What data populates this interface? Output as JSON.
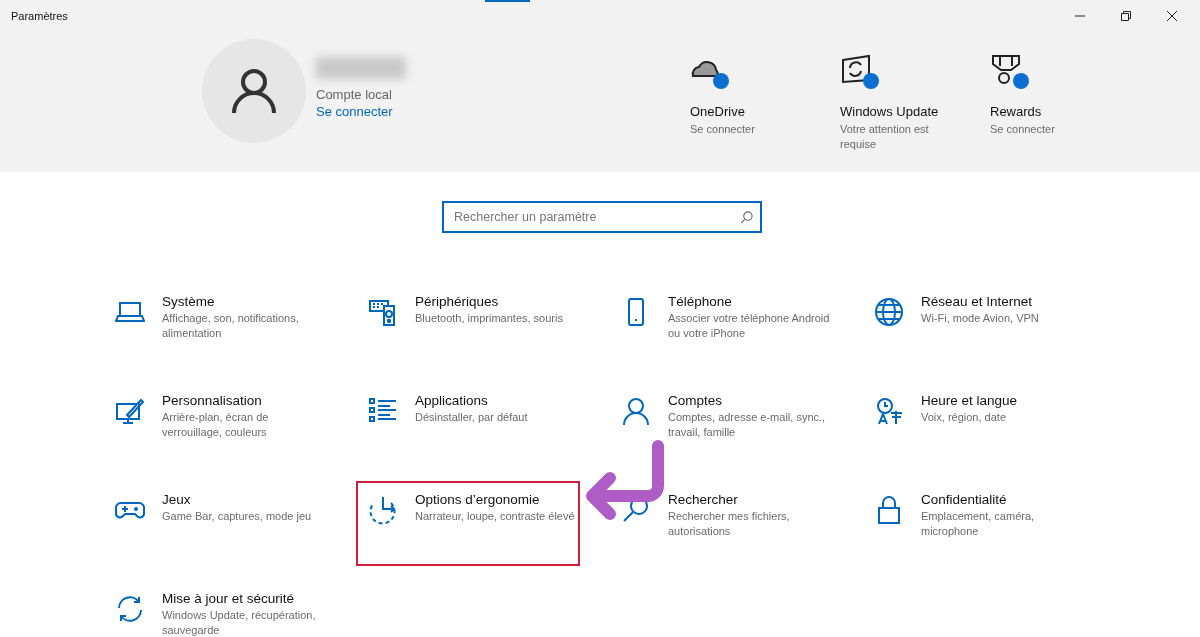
{
  "window": {
    "title": "Paramètres"
  },
  "account": {
    "type": "Compte local",
    "link": "Se connecter"
  },
  "quick_links": [
    {
      "title": "OneDrive",
      "subtitle": "Se connecter"
    },
    {
      "title": "Windows Update",
      "subtitle": "Votre attention est requise"
    },
    {
      "title": "Rewards",
      "subtitle": "Se connecter"
    }
  ],
  "search": {
    "placeholder": "Rechercher un paramètre"
  },
  "categories": [
    {
      "title": "Système",
      "subtitle": "Affichage, son, notifications, alimentation",
      "highlighted": false
    },
    {
      "title": "Périphériques",
      "subtitle": "Bluetooth, imprimantes, souris",
      "highlighted": false
    },
    {
      "title": "Téléphone",
      "subtitle": "Associer votre téléphone Android ou votre iPhone",
      "highlighted": false
    },
    {
      "title": "Réseau et Internet",
      "subtitle": "Wi-Fi, mode Avion, VPN",
      "highlighted": false
    },
    {
      "title": "Personnalisation",
      "subtitle": "Arrière-plan, écran de verrouillage, couleurs",
      "highlighted": false
    },
    {
      "title": "Applications",
      "subtitle": "Désinstaller, par défaut",
      "highlighted": false
    },
    {
      "title": "Comptes",
      "subtitle": "Comptes, adresse e-mail, sync., travail, famille",
      "highlighted": false
    },
    {
      "title": "Heure et langue",
      "subtitle": "Voix, région, date",
      "highlighted": false
    },
    {
      "title": "Jeux",
      "subtitle": "Game Bar, captures, mode jeu",
      "highlighted": false
    },
    {
      "title": "Options d’ergonomie",
      "subtitle": "Narrateur, loupe, contraste élevé",
      "highlighted": true
    },
    {
      "title": "Rechercher",
      "subtitle": "Rechercher mes fichiers, autorisations",
      "highlighted": false
    },
    {
      "title": "Confidentialité",
      "subtitle": "Emplacement, caméra, microphone",
      "highlighted": false
    },
    {
      "title": "Mise à jour et sécurité",
      "subtitle": "Windows Update, récupération, sauvegarde",
      "highlighted": false
    }
  ]
}
